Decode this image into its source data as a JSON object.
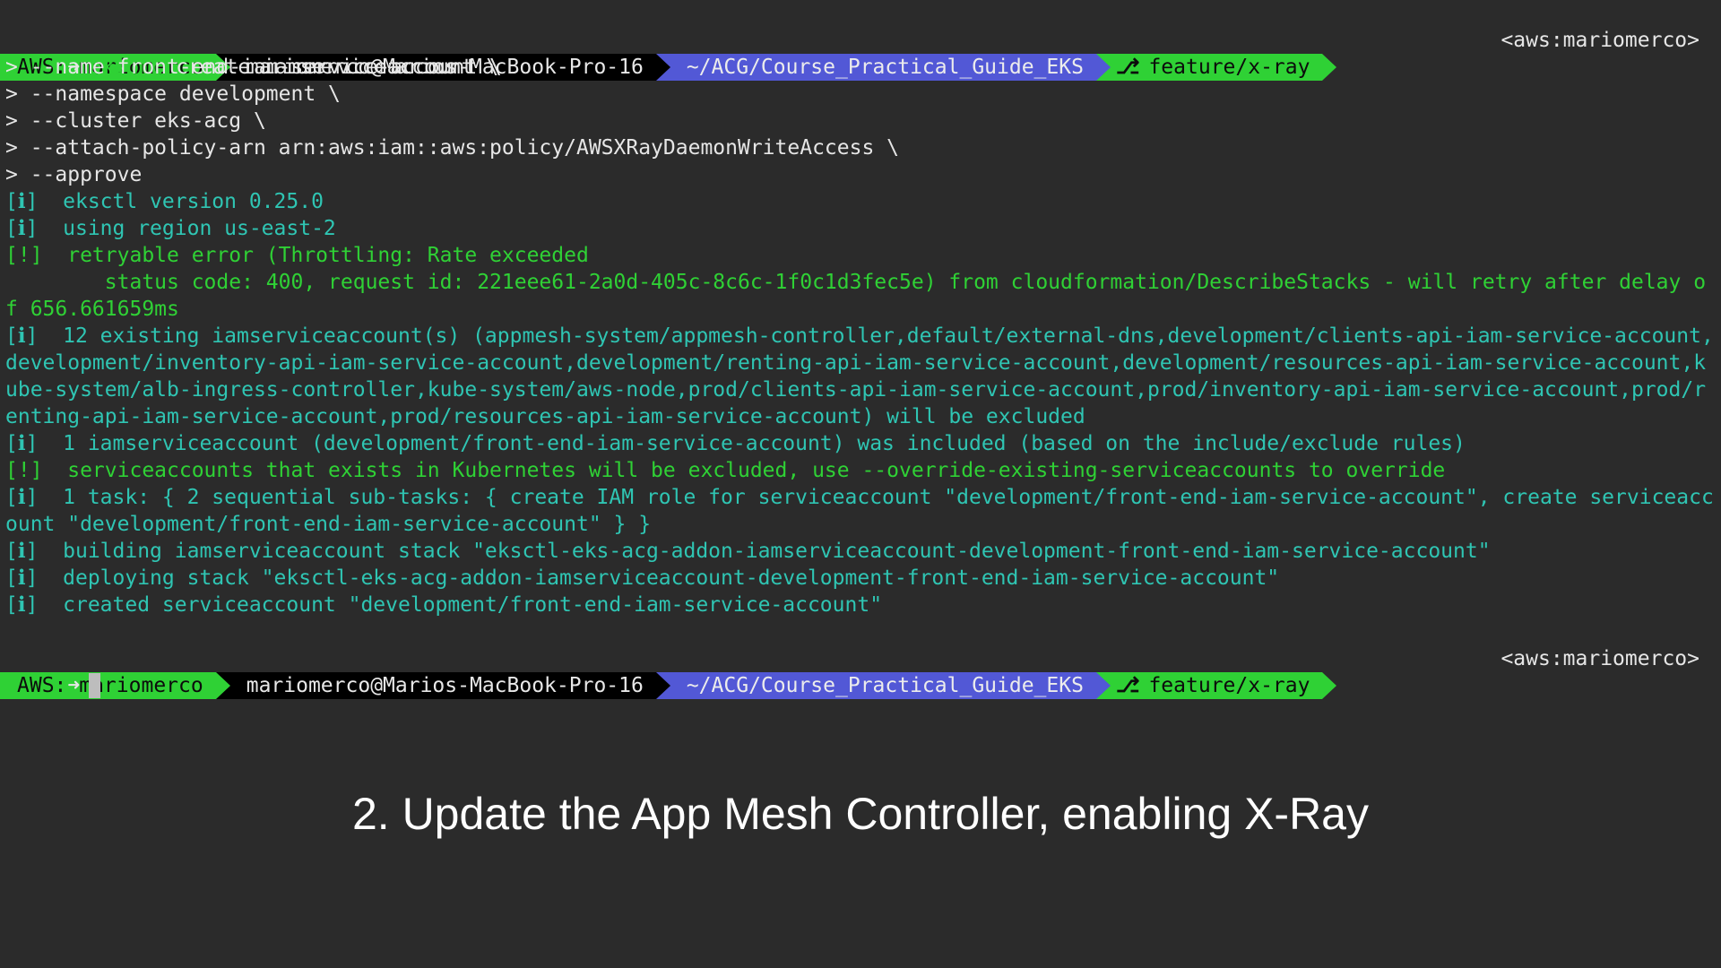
{
  "prompt": {
    "aws": "AWS: mariomerco",
    "host": "mariomerco@Marios-MacBook-Pro-16",
    "path": "~/ACG/Course_Practical_Guide_EKS",
    "branch": "feature/x-ray",
    "right": "<aws:mariomerco>"
  },
  "command": {
    "arrow": "➜",
    "name": "eksctl",
    "line1_rest": " create iamserviceaccount \\",
    "continuations": [
      "> --name front-end-iam-service-account \\",
      "> --namespace development \\",
      "> --cluster eks-acg \\",
      "> --attach-policy-arn arn:aws:iam::aws:policy/AWSXRayDaemonWriteAccess \\",
      "> --approve"
    ]
  },
  "output": [
    {
      "tag": "[ℹ]",
      "kind": "info",
      "text": "  eksctl version 0.25.0"
    },
    {
      "tag": "[ℹ]",
      "kind": "info",
      "text": "  using region us-east-2"
    },
    {
      "tag": "[!]",
      "kind": "warn",
      "text": "  retryable error (Throttling: Rate exceeded\n        status code: 400, request id: 221eee61-2a0d-405c-8c6c-1f0c1d3fec5e) from cloudformation/DescribeStacks - will retry after delay of 656.661659ms"
    },
    {
      "tag": "[ℹ]",
      "kind": "info",
      "text": "  12 existing iamserviceaccount(s) (appmesh-system/appmesh-controller,default/external-dns,development/clients-api-iam-service-account,development/inventory-api-iam-service-account,development/renting-api-iam-service-account,development/resources-api-iam-service-account,kube-system/alb-ingress-controller,kube-system/aws-node,prod/clients-api-iam-service-account,prod/inventory-api-iam-service-account,prod/renting-api-iam-service-account,prod/resources-api-iam-service-account) will be excluded"
    },
    {
      "tag": "[ℹ]",
      "kind": "info",
      "text": "  1 iamserviceaccount (development/front-end-iam-service-account) was included (based on the include/exclude rules)"
    },
    {
      "tag": "[!]",
      "kind": "warn",
      "text": "  serviceaccounts that exists in Kubernetes will be excluded, use --override-existing-serviceaccounts to override"
    },
    {
      "tag": "[ℹ]",
      "kind": "info",
      "text": "  1 task: { 2 sequential sub-tasks: { create IAM role for serviceaccount \"development/front-end-iam-service-account\", create serviceaccount \"development/front-end-iam-service-account\" } }"
    },
    {
      "tag": "[ℹ]",
      "kind": "info",
      "text": "  building iamserviceaccount stack \"eksctl-eks-acg-addon-iamserviceaccount-development-front-end-iam-service-account\""
    },
    {
      "tag": "[ℹ]",
      "kind": "info",
      "text": "  deploying stack \"eksctl-eks-acg-addon-iamserviceaccount-development-front-end-iam-service-account\""
    },
    {
      "tag": "[ℹ]",
      "kind": "info",
      "text": "  created serviceaccount \"development/front-end-iam-service-account\""
    }
  ],
  "caption": "2. Update the App Mesh Controller, enabling X-Ray",
  "colors": {
    "background": "#2b2b2b",
    "prompt_green": "#2fd135",
    "prompt_blue": "#5258d6",
    "info_cyan": "#2fc5b3",
    "warn_green": "#2fd135"
  }
}
